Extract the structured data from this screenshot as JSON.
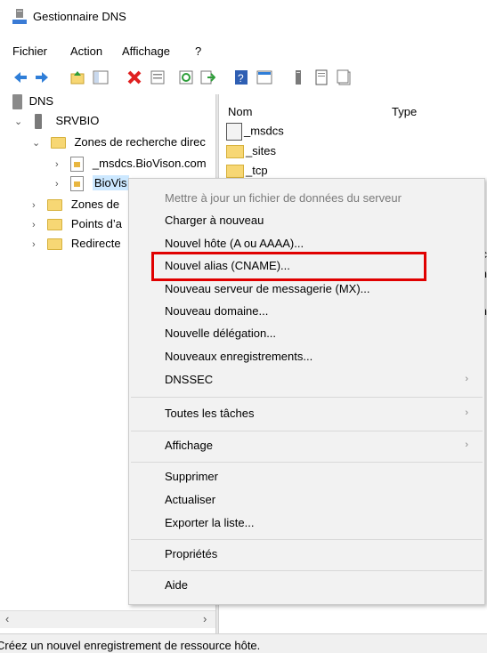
{
  "window": {
    "title": "Gestionnaire DNS"
  },
  "menubar": {
    "items": [
      "Fichier",
      "Action",
      "Affichage",
      "?"
    ]
  },
  "toolbar": {
    "icons": [
      "back-icon",
      "forward-icon",
      "up-folder-icon",
      "show-hide-tree-icon",
      "delete-icon",
      "properties-icon",
      "refresh-icon",
      "export-icon",
      "help-icon",
      "console-icon",
      "server-icon",
      "zone-icon",
      "records-icon"
    ],
    "delete_color": "#e02020"
  },
  "tree": {
    "root": "DNS",
    "server": "SRVBIO",
    "forward_zones": "Zones de recherche direc",
    "msdcs_zone": "_msdcs.BioVison.com",
    "selected_zone": "BioVis",
    "reverse_zones": "Zones de",
    "trust_points": "Points d’a",
    "forwarders": "Redirecte"
  },
  "list": {
    "columns": {
      "name": "Nom",
      "type": "Type"
    },
    "rows": [
      "_msdcs",
      "_sites",
      "_tcp"
    ],
    "clipped_right": [
      "ıc",
      "n",
      "n"
    ]
  },
  "context_menu": {
    "update_server": "Mettre à jour un fichier de données du serveur",
    "reload": "Charger à nouveau",
    "new_host": "Nouvel hôte (A ou AAAA)...",
    "new_alias": "Nouvel alias (CNAME)...",
    "new_mx": "Nouveau serveur de messagerie (MX)...",
    "new_domain": "Nouveau domaine...",
    "new_delegation": "Nouvelle délégation...",
    "new_records": "Nouveaux enregistrements...",
    "dnssec": "DNSSEC",
    "all_tasks": "Toutes les tâches",
    "view": "Affichage",
    "delete": "Supprimer",
    "refresh": "Actualiser",
    "export": "Exporter la liste...",
    "properties": "Propriétés",
    "help": "Aide",
    "highlight_color": "#e00000"
  },
  "statusbar": {
    "text": "Créez un nouvel enregistrement de ressource hôte."
  }
}
